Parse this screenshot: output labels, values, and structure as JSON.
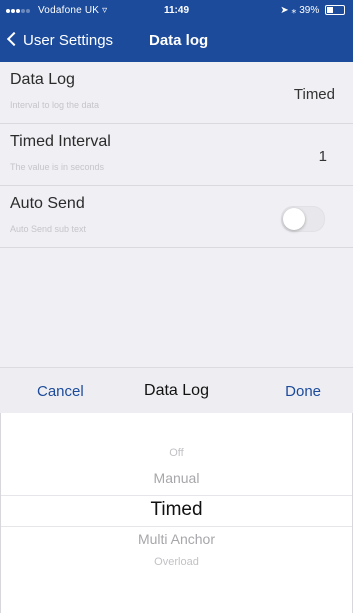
{
  "status_bar": {
    "carrier": "Vodafone UK",
    "time": "11:49",
    "battery_text": "39%",
    "battery_level": 0.39
  },
  "nav": {
    "back_label": "User Settings",
    "title": "Data log",
    "accent_color": "#1c4b9b"
  },
  "rows": [
    {
      "title": "Data Log",
      "subtitle": "Interval to log the data",
      "value": "Timed"
    },
    {
      "title": "Timed Interval",
      "subtitle": "The value is in seconds",
      "value": "1"
    },
    {
      "title": "Auto Send",
      "subtitle": "Auto Send sub text",
      "toggle_on": false
    }
  ],
  "picker": {
    "cancel_label": "Cancel",
    "title": "Data Log",
    "done_label": "Done",
    "options": [
      "Off",
      "Manual",
      "Timed",
      "Multi Anchor",
      "Overload"
    ],
    "selected": "Timed"
  }
}
